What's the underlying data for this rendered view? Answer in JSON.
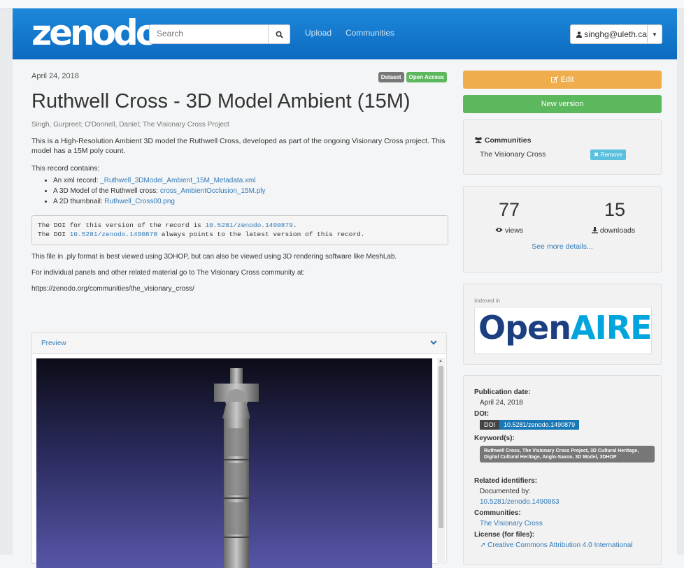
{
  "header": {
    "logo": "zenodo",
    "search_placeholder": "Search",
    "nav": [
      "Upload",
      "Communities"
    ],
    "user": "singhg@uleth.ca"
  },
  "record": {
    "date": "April 24, 2018",
    "badges": [
      "Dataset",
      "Open Access"
    ],
    "title": "Ruthwell Cross - 3D Model Ambient (15M)",
    "authors": "Singh, Gurpreet; O'Donnell, Daniel; The Visionary Cross Project",
    "description": "This is a High-Resolution Ambient 3D model the Ruthwell Cross, developed as part of the ongoing Visionary Cross project. This model has a 15M poly count.",
    "contains_label": "This record contains:",
    "files": [
      {
        "prefix": "An xml record: ",
        "link": "_Ruthwell_3DModel_Ambient_15M_Metadata.xml"
      },
      {
        "prefix": " A 3D Model of the Ruthwell cross: ",
        "link": "cross_AmbientOcclusion_15M.ply"
      },
      {
        "prefix": "A 2D thumbnail: ",
        "link": "Ruthwell_Cross00.png"
      }
    ],
    "doi_line1_a": "The DOI for this version of the record is ",
    "doi_line1_link": "10.5281/zenodo.1490879",
    "doi_line1_b": ".",
    "doi_line2_a": "The DOI ",
    "doi_line2_link": "10.5281/zenodo.1490878",
    "doi_line2_b": " always points to the latest version of this record.",
    "p1": "This file in .ply format is best viewed using 3DHOP, but can also be viewed using 3D rendering software like MeshLab.",
    "p2": "For individual panels and other related material go to The Visionary Cross community at:",
    "p3": "https://zenodo.org/communities/the_visionary_cross/",
    "preview_label": "Preview"
  },
  "sidebar": {
    "edit": "Edit",
    "new_version": "New version",
    "communities_heading": "Communities",
    "community_name": "The Visionary Cross",
    "remove": "Remove",
    "views": "77",
    "views_label": "views",
    "downloads": "15",
    "downloads_label": "downloads",
    "see_more": "See more details...",
    "indexed_in": "Indexed in",
    "openaire_open": "Open",
    "openaire_aire": "AIRE",
    "pub_date_label": "Publication date:",
    "pub_date": "April 24, 2018",
    "doi_label": "DOI:",
    "doi_prefix": "DOI",
    "doi_value": "10.5281/zenodo.1490879",
    "keywords_label": "Keyword(s):",
    "keywords": "Ruthwell Cross, The Visionary Cross Project, 3D Cultural Heritage, Digital Cultural Heritage, Anglo-Saxon, 3D Model, 3DHOP",
    "related_label": "Related identifiers:",
    "documented_by": "Documented by:",
    "related_doi": "10.5281/zenodo.1490863",
    "communities_label": "Communities:",
    "communities_value": "The Visionary Cross",
    "license_label": "License (for files):",
    "license_value": "Creative Commons Attribution 4.0 International"
  },
  "colors": {
    "navbar": "#0b6ac1",
    "edit": "#f0ad4e",
    "new_version": "#5cb85c",
    "link": "#337ab7"
  }
}
